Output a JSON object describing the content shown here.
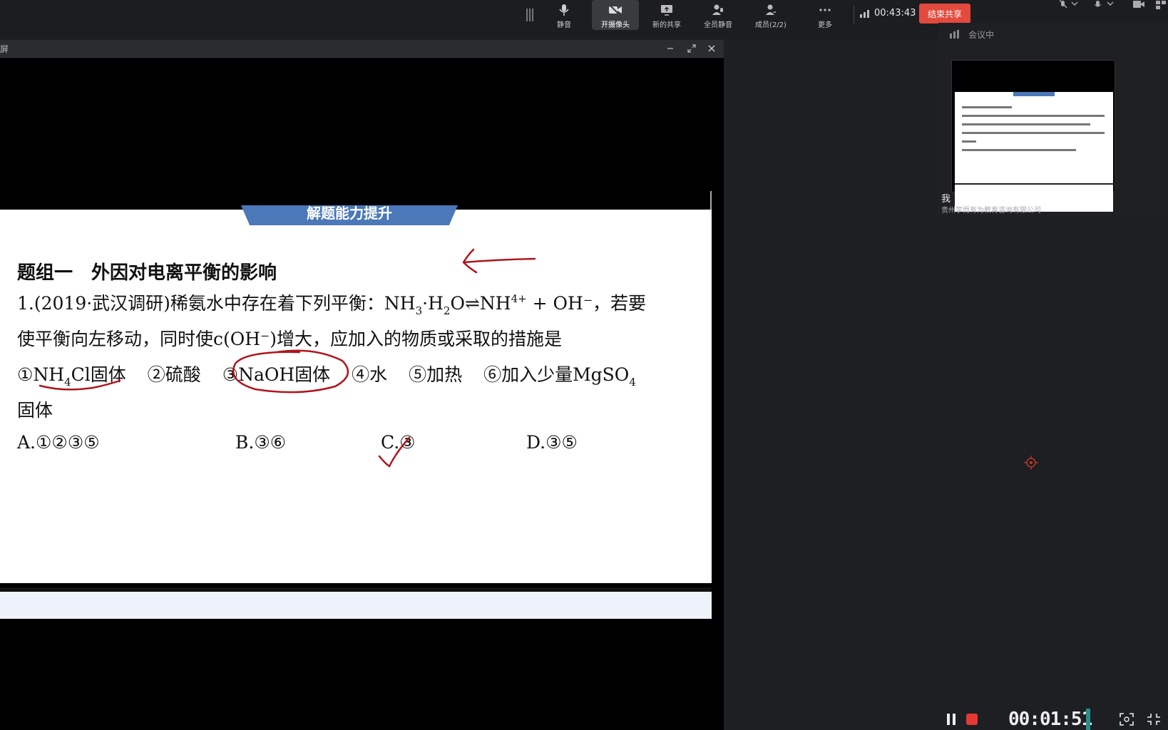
{
  "toolbar": {
    "buttons": [
      {
        "label": "静音",
        "icon": "microphone-icon"
      },
      {
        "label": "开摄像头",
        "icon": "camera-off-icon"
      },
      {
        "label": "新的共享",
        "icon": "share-screen-icon"
      },
      {
        "label": "全员静音",
        "icon": "mute-all-icon"
      },
      {
        "label": "成员(2/2)",
        "icon": "members-icon"
      },
      {
        "label": "更多",
        "icon": "more-icon"
      }
    ],
    "timer": "00:43:43",
    "end_share_label": "结束共享"
  },
  "share_window": {
    "title": "屏"
  },
  "slide": {
    "banner": "解题能力提升",
    "heading": "题组一　外因对电离平衡的影响",
    "question_line1": {
      "prefix": "1.(2019·武汉调研)稀氨水中存在着下列平衡：NH",
      "sub3": "3",
      "mid1": "·H",
      "sub2": "2",
      "mid2": "O⇌NH",
      "sup4": "4+",
      "suffix": " + OH⁻，若要"
    },
    "question_line2": "使平衡向左移动，同时使c(OH⁻)增大，应加入的物质或采取的措施是",
    "options_line": {
      "opt1_a": "①NH",
      "opt1_sub": "4",
      "opt1_b": "Cl固体",
      "opt2": "②硫酸",
      "opt3": "③NaOH固体",
      "opt4": "④水",
      "opt5": "⑤加热",
      "opt6_a": "⑥加入少量MgSO",
      "opt6_sub": "4"
    },
    "options_line2": "固体",
    "choices": [
      "A.①②③⑤",
      "B.③⑥",
      "C.③",
      "D.③⑤"
    ]
  },
  "meeting_panel": {
    "header": "会议中",
    "self_label": "我",
    "company": "贵州学而有为教育咨询有限公司"
  },
  "recorder": {
    "time": "00:01:51"
  },
  "colors": {
    "end_button": "#e24a3e",
    "annotation": "#b0141c",
    "banner": "#4a78b8"
  }
}
